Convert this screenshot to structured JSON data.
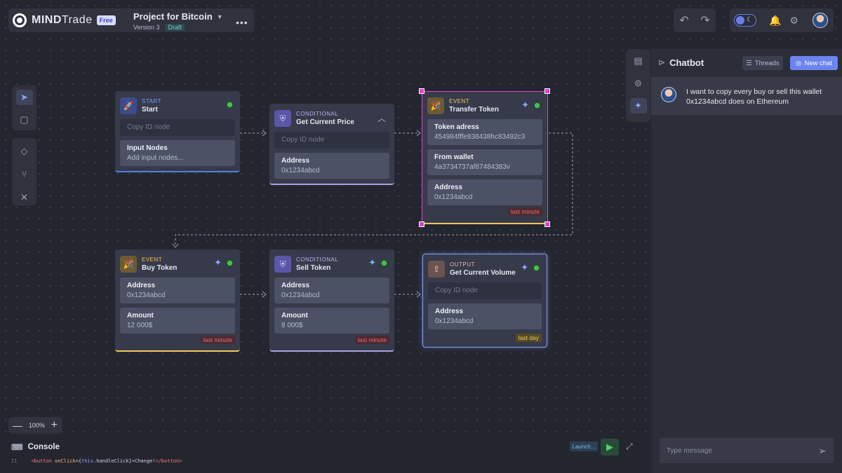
{
  "brand": {
    "name_bold": "MIND",
    "name_light": "Trade",
    "plan": "Free"
  },
  "project": {
    "title": "Project for Bitcoin",
    "version": "Version 3",
    "status": "Draft"
  },
  "header": {
    "more_icon": "more-icon",
    "undo_icon": "undo-icon",
    "redo_icon": "redo-icon"
  },
  "nodes": {
    "start": {
      "type": "Start",
      "name": "Start",
      "copy_placeholder": "Copy ID node",
      "field_label": "Input Nodes",
      "field_value": "Add input nodes..."
    },
    "price": {
      "type": "Conditional",
      "name": "Get Current Price",
      "copy_placeholder": "Copy ID node",
      "field_label": "Address",
      "field_value": "0x1234abcd"
    },
    "transfer": {
      "type": "Event",
      "name": "Transfer Token",
      "fields": [
        {
          "label": "Token adress",
          "value": "454984fffe838438hc83492c3"
        },
        {
          "label": "From wallet",
          "value": "4a3734737af87484383v"
        },
        {
          "label": "Address",
          "value": "0x1234abcd"
        }
      ],
      "badge": "last minute"
    },
    "buy": {
      "type": "Event",
      "name": "Buy Token",
      "fields": [
        {
          "label": "Address",
          "value": "0x1234abcd"
        },
        {
          "label": "Amount",
          "value": "12 000$"
        }
      ],
      "badge": "last minute"
    },
    "sell": {
      "type": "Conditional",
      "name": "Sell Token",
      "fields": [
        {
          "label": "Address",
          "value": "0x1234abcd"
        },
        {
          "label": "Amount",
          "value": "8 000$"
        }
      ],
      "badge": "last minute"
    },
    "volume": {
      "type": "Output",
      "name": "Get Current Volume",
      "copy_placeholder": "Copy ID node",
      "field_label": "Address",
      "field_value": "0x1234abcd",
      "badge": "last day"
    }
  },
  "chat": {
    "title": "Chatbot",
    "threads_label": "Threads",
    "new_chat_label": "New chat",
    "message": "I want to copy every buy or sell this wallet 0x1234abcd does on Ethereum",
    "input_placeholder": "Type message"
  },
  "zoom": {
    "level": "100%"
  },
  "console": {
    "title": "Console",
    "line_number": "21",
    "launch_label": "Launch..."
  },
  "colors": {
    "accent": "#6c84ef",
    "success": "#36c24a",
    "selected": "#e040d0",
    "warning": "#f0c85a",
    "danger": "#f06a6a"
  }
}
